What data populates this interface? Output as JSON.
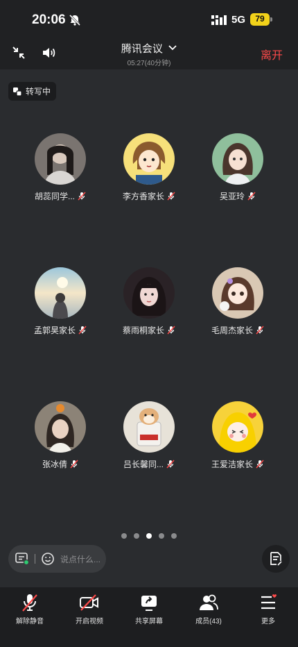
{
  "status_bar": {
    "time": "20:06",
    "network": "5G",
    "battery": "79"
  },
  "header": {
    "title": "腾讯会议",
    "duration": "05:27(40分钟)",
    "leave_label": "离开"
  },
  "transcribe_label": "转写中",
  "participants": [
    {
      "name": "胡蕊同学...",
      "avatar_bg": "#6f6a67"
    },
    {
      "name": "李方香家长",
      "avatar_bg": "#f6e07a"
    },
    {
      "name": "吴亚玲",
      "avatar_bg": "#7fb08e"
    },
    {
      "name": "孟郭昊家长",
      "avatar_bg": "#c9b8a2"
    },
    {
      "name": "蔡雨桐家长",
      "avatar_bg": "#3a2c2c"
    },
    {
      "name": "毛周杰家长",
      "avatar_bg": "#d8c6b2"
    },
    {
      "name": "张冰倩",
      "avatar_bg": "#8a8178"
    },
    {
      "name": "吕长馨同...",
      "avatar_bg": "#e7e2d8"
    },
    {
      "name": "王爱洁家长",
      "avatar_bg": "#f7d23a"
    }
  ],
  "pagination": {
    "pages": 5,
    "current": 3
  },
  "chat": {
    "placeholder": "说点什么..."
  },
  "toolbar": {
    "unmute": "解除静音",
    "video": "开启视频",
    "share": "共享屏幕",
    "members": "成员(43)",
    "more": "更多"
  }
}
